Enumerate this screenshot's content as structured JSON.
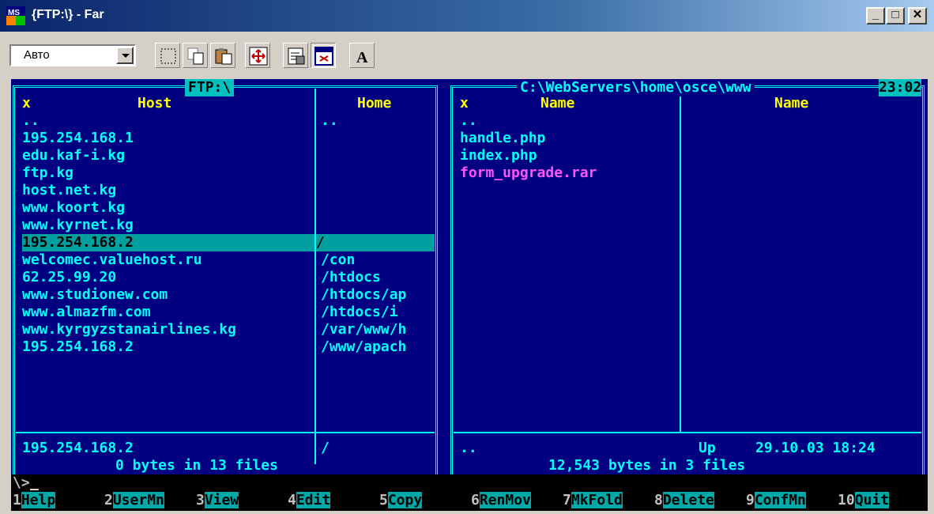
{
  "window": {
    "title": "{FTP:\\} - Far",
    "icon_text": "MS",
    "controls": [
      "_",
      "□",
      "✕"
    ]
  },
  "toolbar": {
    "font_mode": "Авто",
    "buttons": [
      "select-icon",
      "copy-icon",
      "paste-icon",
      "fullscreen-icon",
      "properties-icon",
      "defaults-icon",
      "font-icon"
    ],
    "font_label": "A"
  },
  "left_panel": {
    "title": "FTP:\\",
    "columns": [
      "x",
      "Host",
      "Home"
    ],
    "rows": [
      {
        "host": "..",
        "home": ".."
      },
      {
        "host": "195.254.168.1",
        "home": ""
      },
      {
        "host": "edu.kaf-i.kg",
        "home": ""
      },
      {
        "host": "ftp.kg",
        "home": ""
      },
      {
        "host": "host.net.kg",
        "home": ""
      },
      {
        "host": "www.koort.kg",
        "home": ""
      },
      {
        "host": "www.kyrnet.kg",
        "home": ""
      },
      {
        "host": "195.254.168.2",
        "home": "/"
      },
      {
        "host": "welcomec.valuehost.ru",
        "home": "/con"
      },
      {
        "host": "62.25.99.20",
        "home": "/htdocs"
      },
      {
        "host": "www.studionew.com",
        "home": "/htdocs/ap"
      },
      {
        "host": "www.almazfm.com",
        "home": "/htdocs/i"
      },
      {
        "host": "www.kyrgyzstanairlines.kg",
        "home": "/var/www/h"
      },
      {
        "host": "195.254.168.2",
        "home": "/www/apach"
      }
    ],
    "selected_index": 7,
    "status_host": "195.254.168.2",
    "status_home": "/",
    "summary": "0 bytes in 13 files"
  },
  "right_panel": {
    "title": "C:\\WebServers\\home\\osce\\www",
    "clock": "23:02",
    "columns": [
      "x",
      "Name",
      "Name"
    ],
    "files": [
      {
        "name": "..",
        "type": "dir"
      },
      {
        "name": "handle.php",
        "type": "file"
      },
      {
        "name": "index.php",
        "type": "file"
      },
      {
        "name": "form_upgrade.rar",
        "type": "archive"
      }
    ],
    "status_name": "..",
    "status_size": "Up",
    "status_date": "29.10.03 18:24",
    "summary": "12,543 bytes in 3 files"
  },
  "command_line": {
    "prompt": "\\>"
  },
  "keybar": [
    {
      "num": "1",
      "label": "Help"
    },
    {
      "num": "2",
      "label": "UserMn"
    },
    {
      "num": "3",
      "label": "View"
    },
    {
      "num": "4",
      "label": "Edit"
    },
    {
      "num": "5",
      "label": "Copy"
    },
    {
      "num": "6",
      "label": "RenMov"
    },
    {
      "num": "7",
      "label": "MkFold"
    },
    {
      "num": "8",
      "label": "Delete"
    },
    {
      "num": "9",
      "label": "ConfMn"
    },
    {
      "num": "10",
      "label": "Quit"
    }
  ],
  "colors": {
    "panel_bg": "#000080",
    "text": "#00ffff",
    "header": "#ffff00",
    "cursor": "#00a0a0",
    "archive": "#ff55ff"
  }
}
